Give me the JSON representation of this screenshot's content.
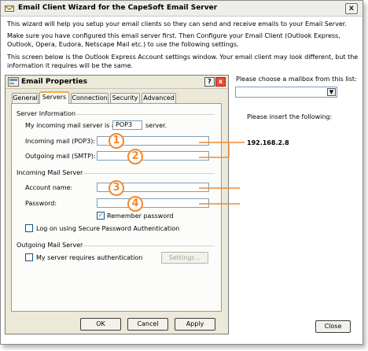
{
  "window": {
    "title": "Email Client Wizard for the CapeSoft Email Server",
    "close_label": "x",
    "intro_1": "This wizard will help you setup your email clients so they can send and receive emails to your Email Server.",
    "intro_2": "Make sure you have configured this email server first. Then Configure your Email Client (Outlook Express, Outlook, Opera, Eudora, Netscape Mail etc.) to use the following settings.",
    "intro_3": "This screen below is the Outlook Express Account settings window. Your email client may look different, but the information it requires will be the same."
  },
  "mailbox": {
    "choose_label": "Please choose a mailbox from this list:",
    "selected": "",
    "insert_label": "Please insert the following:",
    "server_ip": "192.168.2.8"
  },
  "close_button": "Close",
  "dialog": {
    "title": "Email Properties",
    "help_label": "?",
    "close_label": "x",
    "tabs": [
      "General",
      "Servers",
      "Connection",
      "Security",
      "Advanced"
    ],
    "active_tab": "Servers",
    "server_info_heading": "Server Information",
    "incoming_type_prefix": "My incoming mail server is a",
    "incoming_type_value": "POP3",
    "incoming_type_suffix": "server.",
    "incoming_label": "Incoming mail (POP3):",
    "outgoing_label": "Outgoing mail (SMTP):",
    "incoming_server_heading": "Incoming Mail Server",
    "account_label": "Account name:",
    "password_label": "Password:",
    "remember_label": "Remember password",
    "remember_checked": true,
    "spa_label": "Log on using Secure Password Authentication",
    "spa_checked": false,
    "outgoing_server_heading": "Outgoing Mail Server",
    "auth_label": "My server requires authentication",
    "auth_checked": false,
    "settings_button": "Settings...",
    "ok_button": "OK",
    "cancel_button": "Cancel",
    "apply_button": "Apply"
  },
  "markers": [
    "1",
    "2",
    "3",
    "4"
  ],
  "colors": {
    "accent": "#f28a2e",
    "titlebar": "#ededea",
    "dialog_bg": "#ece9d8",
    "field_border": "#7f9db9"
  }
}
